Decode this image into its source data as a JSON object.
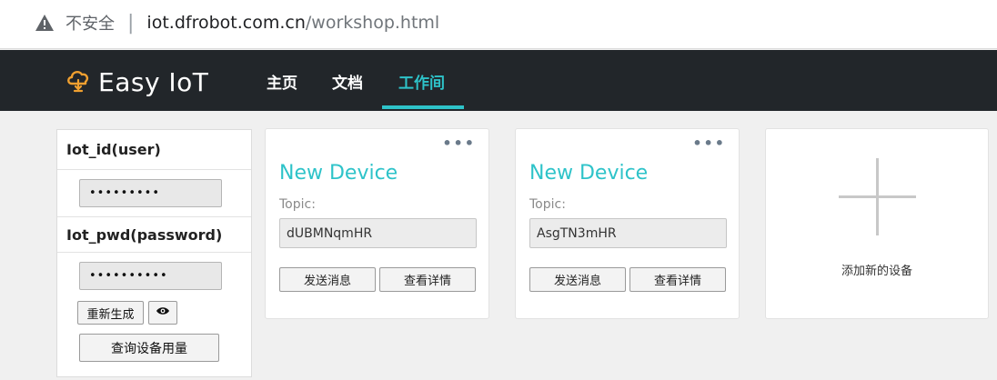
{
  "address_bar": {
    "security_text": "不安全",
    "separator": "|",
    "url_host": "iot.dfrobot.com.cn",
    "url_path": "/workshop.html"
  },
  "navbar": {
    "brand": "Easy IoT",
    "items": [
      {
        "label": "主页"
      },
      {
        "label": "文档"
      },
      {
        "label": "工作间",
        "active": true
      }
    ],
    "accent_color": "#2ec3c9",
    "background_color": "#22262a"
  },
  "credentials": {
    "user_label": "Iot_id(user)",
    "user_value": "•••••••••",
    "pwd_label": "Iot_pwd(password)",
    "pwd_value": "••••••••••",
    "regenerate_label": "重新生成",
    "show_icon": "eye-icon",
    "query_label": "查询设备用量"
  },
  "devices": [
    {
      "name": "New Device",
      "topic_label": "Topic:",
      "topic": "dUBMNqmHR",
      "send_label": "发送消息",
      "detail_label": "查看详情",
      "more": "•••"
    },
    {
      "name": "New Device",
      "topic_label": "Topic:",
      "topic": "AsgTN3mHR",
      "send_label": "发送消息",
      "detail_label": "查看详情",
      "more": "•••"
    }
  ],
  "add_device": {
    "label": "添加新的设备",
    "icon": "plus-icon"
  }
}
